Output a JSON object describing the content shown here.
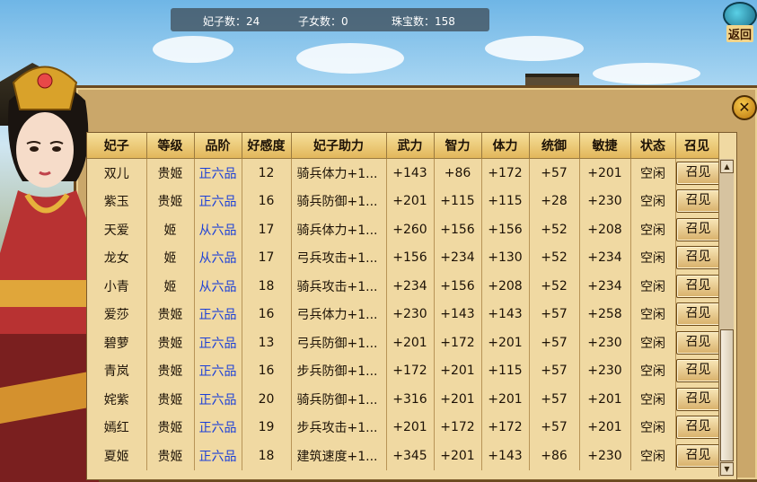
{
  "status": {
    "consorts_label": "妃子数：",
    "consorts_count": "24",
    "children_label": "子女数：",
    "children_count": "0",
    "jewels_label": "珠宝数：",
    "jewels_count": "158"
  },
  "back_button": {
    "label": "返回"
  },
  "close_button": {
    "label": "✕"
  },
  "table": {
    "headers": [
      "妃子",
      "等级",
      "品阶",
      "好感度",
      "妃子助力",
      "武力",
      "智力",
      "体力",
      "统御",
      "敏捷",
      "状态",
      "召见"
    ],
    "rows": [
      {
        "name": "双儿",
        "level": "贵姬",
        "rank": "正六品",
        "favor": "12",
        "assist": "骑兵体力+1...",
        "force": "+143",
        "intel": "+86",
        "stamina": "+172",
        "command": "+57",
        "agility": "+201",
        "state": "空闲",
        "action": "召见"
      },
      {
        "name": "紫玉",
        "level": "贵姬",
        "rank": "正六品",
        "favor": "16",
        "assist": "骑兵防御+1...",
        "force": "+201",
        "intel": "+115",
        "stamina": "+115",
        "command": "+28",
        "agility": "+230",
        "state": "空闲",
        "action": "召见"
      },
      {
        "name": "天爱",
        "level": "姬",
        "rank": "从六品",
        "favor": "17",
        "assist": "骑兵体力+1...",
        "force": "+260",
        "intel": "+156",
        "stamina": "+156",
        "command": "+52",
        "agility": "+208",
        "state": "空闲",
        "action": "召见"
      },
      {
        "name": "龙女",
        "level": "姬",
        "rank": "从六品",
        "favor": "17",
        "assist": "弓兵攻击+1...",
        "force": "+156",
        "intel": "+234",
        "stamina": "+130",
        "command": "+52",
        "agility": "+234",
        "state": "空闲",
        "action": "召见"
      },
      {
        "name": "小青",
        "level": "姬",
        "rank": "从六品",
        "favor": "18",
        "assist": "骑兵攻击+1...",
        "force": "+234",
        "intel": "+156",
        "stamina": "+208",
        "command": "+52",
        "agility": "+234",
        "state": "空闲",
        "action": "召见"
      },
      {
        "name": "爱莎",
        "level": "贵姬",
        "rank": "正六品",
        "favor": "16",
        "assist": "弓兵体力+1...",
        "force": "+230",
        "intel": "+143",
        "stamina": "+143",
        "command": "+57",
        "agility": "+258",
        "state": "空闲",
        "action": "召见"
      },
      {
        "name": "碧萝",
        "level": "贵姬",
        "rank": "正六品",
        "favor": "13",
        "assist": "弓兵防御+1...",
        "force": "+201",
        "intel": "+172",
        "stamina": "+201",
        "command": "+57",
        "agility": "+230",
        "state": "空闲",
        "action": "召见"
      },
      {
        "name": "青岚",
        "level": "贵姬",
        "rank": "正六品",
        "favor": "16",
        "assist": "步兵防御+1...",
        "force": "+172",
        "intel": "+201",
        "stamina": "+115",
        "command": "+57",
        "agility": "+230",
        "state": "空闲",
        "action": "召见"
      },
      {
        "name": "姹紫",
        "level": "贵姬",
        "rank": "正六品",
        "favor": "20",
        "assist": "骑兵防御+1...",
        "force": "+316",
        "intel": "+201",
        "stamina": "+201",
        "command": "+57",
        "agility": "+201",
        "state": "空闲",
        "action": "召见"
      },
      {
        "name": "嫣红",
        "level": "贵姬",
        "rank": "正六品",
        "favor": "19",
        "assist": "步兵攻击+1...",
        "force": "+201",
        "intel": "+172",
        "stamina": "+172",
        "command": "+57",
        "agility": "+201",
        "state": "空闲",
        "action": "召见"
      },
      {
        "name": "夏姬",
        "level": "贵姬",
        "rank": "正六品",
        "favor": "18",
        "assist": "建筑速度+1...",
        "force": "+345",
        "intel": "+201",
        "stamina": "+143",
        "command": "+86",
        "agility": "+230",
        "state": "空闲",
        "action": "召见"
      }
    ]
  },
  "colors": {
    "rank_text": "#1b3fd8",
    "panel_bg": "#caa76a",
    "table_bg": "#f0d9a2"
  }
}
